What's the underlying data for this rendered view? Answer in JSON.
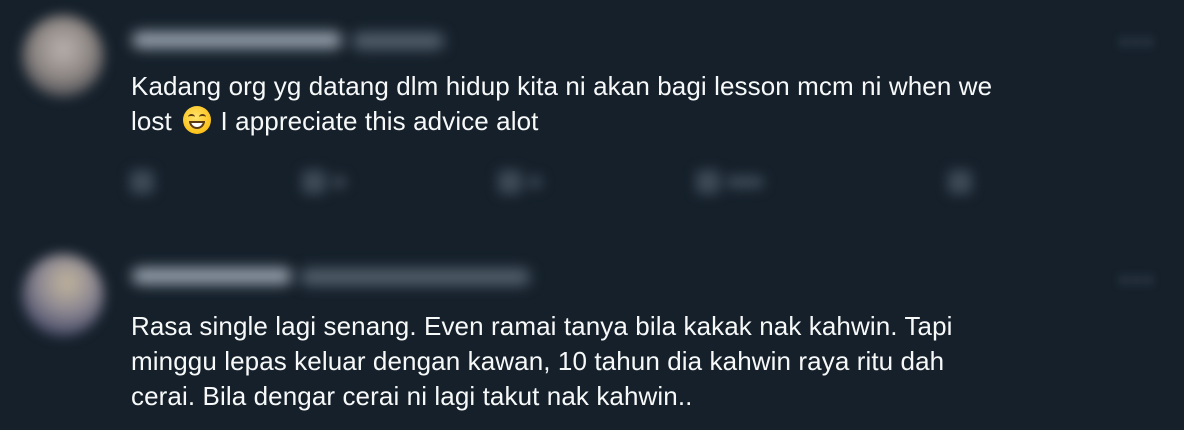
{
  "replies": [
    {
      "text_lines": [
        "Kadang org yg datang dlm hidup kita ni akan bagi lesson mcm ni when we",
        "lost",
        "I appreciate this advice alot"
      ],
      "emoji": "grinning-face-with-smiling-eyes"
    },
    {
      "text_lines": [
        "Rasa single lagi senang. Even ramai tanya bila kakak nak kahwin. Tapi",
        "minggu lepas keluar dengan kawan, 10 tahun dia kahwin raya ritu dah",
        "cerai. Bila dengar cerai ni lagi takut nak kahwin.."
      ]
    }
  ],
  "colors": {
    "background": "#15202b",
    "text": "#f7f9f9",
    "muted": "#56636f"
  },
  "icons": {
    "actions": [
      "reply-icon",
      "retweet-icon",
      "like-icon",
      "views-icon",
      "bookmark-icon"
    ],
    "more": "more-icon"
  }
}
